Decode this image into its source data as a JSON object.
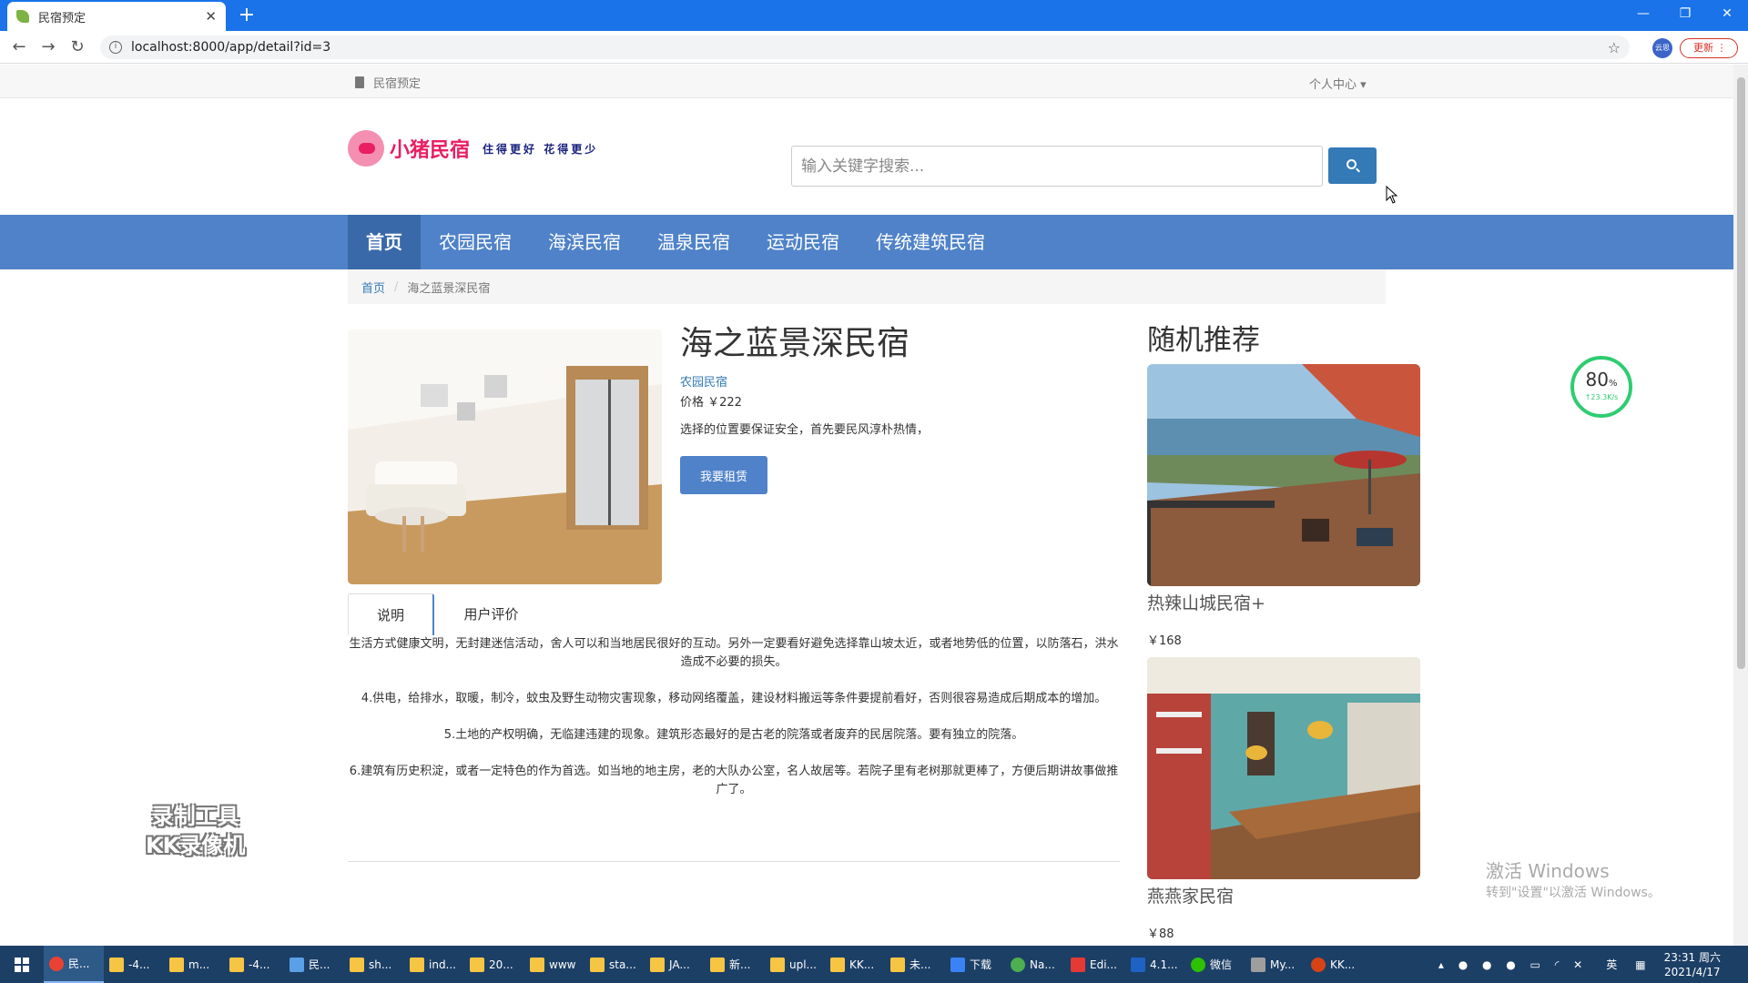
{
  "browser": {
    "tab_title": "民宿预定",
    "url": "localhost:8000/app/detail?id=3",
    "update_label": "更新",
    "profile_label": "云思"
  },
  "topnav": {
    "brand": "民宿预定",
    "user_center": "个人中心 ▾"
  },
  "header": {
    "logo_text": "小猪民宿",
    "slogan": "住得更好 花得更少",
    "search_placeholder": "输入关键字搜索..."
  },
  "mainnav": {
    "items": [
      "首页",
      "农园民宿",
      "海滨民宿",
      "温泉民宿",
      "运动民宿",
      "传统建筑民宿"
    ]
  },
  "breadcrumb": {
    "home": "首页",
    "separator": "/",
    "current": "海之蓝景深民宿"
  },
  "detail": {
    "title": "海之蓝景深民宿",
    "category": "农园民宿",
    "price": "价格 ￥222",
    "brief": "选择的位置要保证安全，首先要民风淳朴热情，",
    "rent_button": "我要租赁"
  },
  "tabs": {
    "description": "说明",
    "reviews": "用户评价"
  },
  "description": {
    "p1": "生活方式健康文明，无封建迷信活动，舍人可以和当地居民很好的互动。另外一定要看好避免选择靠山坡太近，或者地势低的位置，以防落石，洪水造成不必要的损失。",
    "p2": "4.供电，给排水，取暖，制冷，蚊虫及野生动物灾害现象，移动网络覆盖，建设材料搬运等条件要提前看好，否则很容易造成后期成本的增加。",
    "p3": "5.土地的产权明确，无临建违建的现象。建筑形态最好的是古老的院落或者废弃的民居院落。要有独立的院落。",
    "p4": "6.建筑有历史积淀，或者一定特色的作为首选。如当地的地主房，老的大队办公室，名人故居等。若院子里有老树那就更棒了，方便后期讲故事做推广了。"
  },
  "recommend": {
    "title": "随机推荐",
    "items": [
      {
        "name": "热辣山城民宿+",
        "price": "￥168"
      },
      {
        "name": "燕燕家民宿",
        "price": "￥88"
      }
    ]
  },
  "overlay": {
    "speed_pct": "80",
    "speed_unit": "%",
    "speed_rate": "↑23.3K/s",
    "watermark_line1": "录制工具",
    "watermark_line2": "KK录像机",
    "activate_line1": "激活 Windows",
    "activate_line2": "转到\"设置\"以激活 Windows。"
  },
  "taskbar": {
    "items": [
      "民...",
      "-4...",
      "m...",
      "-4...",
      "民...",
      "sh...",
      "ind...",
      "20...",
      "www",
      "sta...",
      "JA...",
      "新...",
      "upl...",
      "KK...",
      "未...",
      "下载",
      "Na...",
      "Edi...",
      "4.1...",
      "微信",
      "My...",
      "KK..."
    ],
    "ime": "英",
    "time": "23:31 周六",
    "date": "2021/4/17"
  },
  "colors": {
    "nav_blue": "#4f82c9",
    "nav_active": "#3969a8",
    "logo_pink": "#e91e63",
    "chrome_blue": "#1a73e8",
    "taskbar": "#1c3f66"
  }
}
